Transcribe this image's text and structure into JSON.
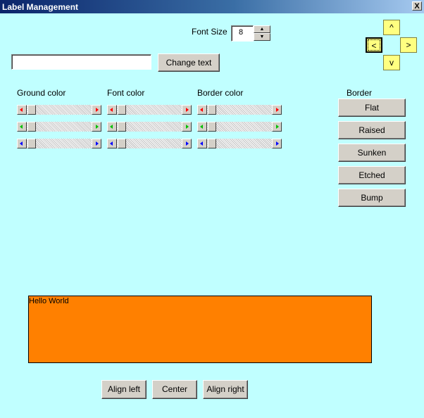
{
  "window": {
    "title": "Label Management",
    "close_label": "X"
  },
  "font_size": {
    "label": "Font Size",
    "value": "8",
    "up_glyph": "▲",
    "down_glyph": "▼"
  },
  "text_input": {
    "value": "",
    "button_label": "Change text"
  },
  "nav_buttons": {
    "up": "^",
    "left": "<",
    "right": ">",
    "down": "v"
  },
  "color_groups": [
    {
      "label": "Ground color"
    },
    {
      "label": "Font color"
    },
    {
      "label": "Border color"
    }
  ],
  "channel_colors": {
    "red": "#ff0000",
    "green": "#00c000",
    "blue": "#0000ff"
  },
  "border": {
    "label": "Border",
    "options": [
      "Flat",
      "Raised",
      "Sunken",
      "Etched",
      "Bump"
    ]
  },
  "preview": {
    "text": "Hello World",
    "background": "#ff8000"
  },
  "align_buttons": [
    "Align left",
    "Center",
    "Align right"
  ]
}
